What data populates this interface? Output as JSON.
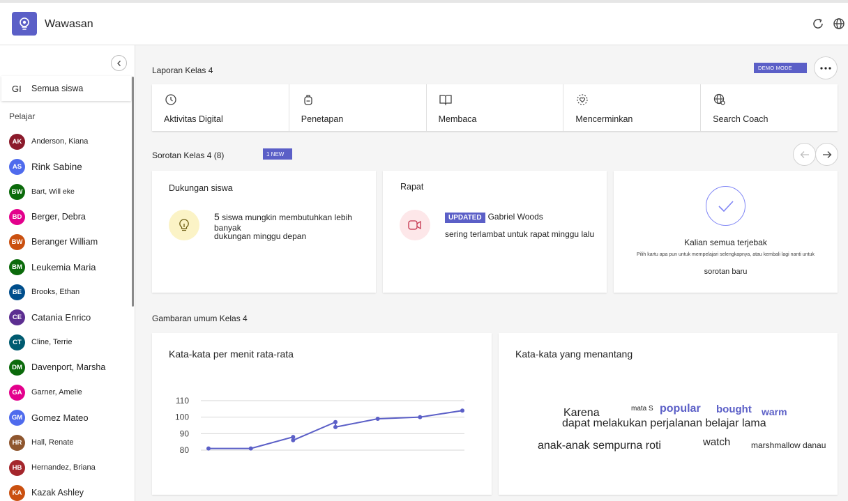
{
  "app": {
    "title": "Wawasan"
  },
  "sidebar": {
    "all_students": {
      "initials": "GI",
      "label": "Semua siswa"
    },
    "learners_label": "Pelajar",
    "students": [
      {
        "initials": "AK",
        "name": "Anderson, Kiana",
        "color": "#8b1a2b",
        "size": "11px"
      },
      {
        "initials": "AS",
        "name": "Rink Sabine",
        "color": "#4f6bed",
        "size": "13.5px"
      },
      {
        "initials": "BW",
        "name": "Bart, Will eke",
        "color": "#0b6a0b",
        "size": "10.5px"
      },
      {
        "initials": "BD",
        "name": "Berger, Debra",
        "color": "#e3008c",
        "size": "12.5px"
      },
      {
        "initials": "BW",
        "name": "Beranger William",
        "color": "#ca5010",
        "size": "12.5px"
      },
      {
        "initials": "BM",
        "name": "Leukemia Maria",
        "color": "#0b6a0b",
        "size": "13px"
      },
      {
        "initials": "BE",
        "name": "Brooks, Ethan",
        "color": "#004e8c",
        "size": "11px"
      },
      {
        "initials": "CE",
        "name": "Catania Enrico",
        "color": "#5c2e91",
        "size": "13px"
      },
      {
        "initials": "CT",
        "name": "Cline, Terrie",
        "color": "#005b70",
        "size": "11px"
      },
      {
        "initials": "DM",
        "name": "Davenport, Marsha",
        "color": "#0b6a0b",
        "size": "12.5px"
      },
      {
        "initials": "GA",
        "name": "Garner, Amelie",
        "color": "#e3008c",
        "size": "11px"
      },
      {
        "initials": "GM",
        "name": "Gomez Mateo",
        "color": "#4f6bed",
        "size": "13px"
      },
      {
        "initials": "HR",
        "name": "Hall, Renate",
        "color": "#8e562e",
        "size": "11px"
      },
      {
        "initials": "HB",
        "name": "Hernandez, Briana",
        "color": "#a4262c",
        "size": "11px"
      },
      {
        "initials": "KA",
        "name": "Kazak Ashley",
        "color": "#ca5010",
        "size": "12.5px"
      }
    ]
  },
  "report": {
    "title": "Laporan Kelas 4",
    "demo_mode": "DEMO MODE",
    "tabs": [
      {
        "label": "Aktivitas Digital",
        "icon": "clock-icon"
      },
      {
        "label": "Penetapan",
        "icon": "backpack-icon"
      },
      {
        "label": "Membaca",
        "icon": "book-icon"
      },
      {
        "label": "Mencerminkan",
        "icon": "heart-reflect-icon"
      },
      {
        "label": "Search Coach",
        "icon": "globe-search-icon"
      }
    ]
  },
  "spotlight": {
    "title": "Sorotan Kelas 4 (8)",
    "new_badge": "1 NEW",
    "cards": {
      "support": {
        "title": "Dukungan siswa",
        "count": "5",
        "line1": "siswa mungkin membutuhkan lebih banyak",
        "line2": "dukungan minggu depan"
      },
      "meeting": {
        "title": "Rapat",
        "badge": "UPDATED",
        "name": "Gabriel Woods",
        "line2": "sering terlambat untuk rapat minggu lalu"
      },
      "caught_up": {
        "title": "Kalian semua terjebak",
        "line1": "Pilih kartu apa pun untuk mempelajari selengkapnya, atau kembali lagi nanti untuk",
        "line2": "sorotan baru"
      }
    }
  },
  "overview": {
    "title": "Gambaran umum Kelas 4",
    "wpm_card_title": "Kata-kata per menit rata-rata",
    "words_card_title": "Kata-kata yang menantang",
    "words": [
      {
        "text": "Karena",
        "color": "#242424"
      },
      {
        "text": "mata S",
        "color": "#242424"
      },
      {
        "text": "popular",
        "color": "#5b5fc7"
      },
      {
        "text": "bought",
        "color": "#5b5fc7"
      },
      {
        "text": "warm",
        "color": "#5b5fc7"
      },
      {
        "text": "dapat melakukan perjalanan belajar lama",
        "color": "#242424"
      },
      {
        "text": "anak-anak sempurna roti",
        "color": "#242424"
      },
      {
        "text": "watch",
        "color": "#242424"
      },
      {
        "text": "marshmallow danau",
        "color": "#242424"
      }
    ]
  },
  "chart_data": {
    "type": "line",
    "title": "Kata-kata per menit rata-rata",
    "y_ticks": [
      "110",
      "100",
      "90",
      "80"
    ],
    "ylim": [
      80,
      110
    ],
    "series": [
      {
        "points": [
          [
            1,
            81
          ],
          [
            2,
            81
          ],
          [
            3,
            88
          ],
          [
            3,
            86
          ],
          [
            4,
            97
          ],
          [
            4,
            94
          ],
          [
            5,
            99
          ],
          [
            6,
            100
          ],
          [
            7,
            104
          ]
        ]
      }
    ],
    "x_range": [
      1,
      7
    ],
    "color": "#5b5fc7",
    "grid": true
  }
}
